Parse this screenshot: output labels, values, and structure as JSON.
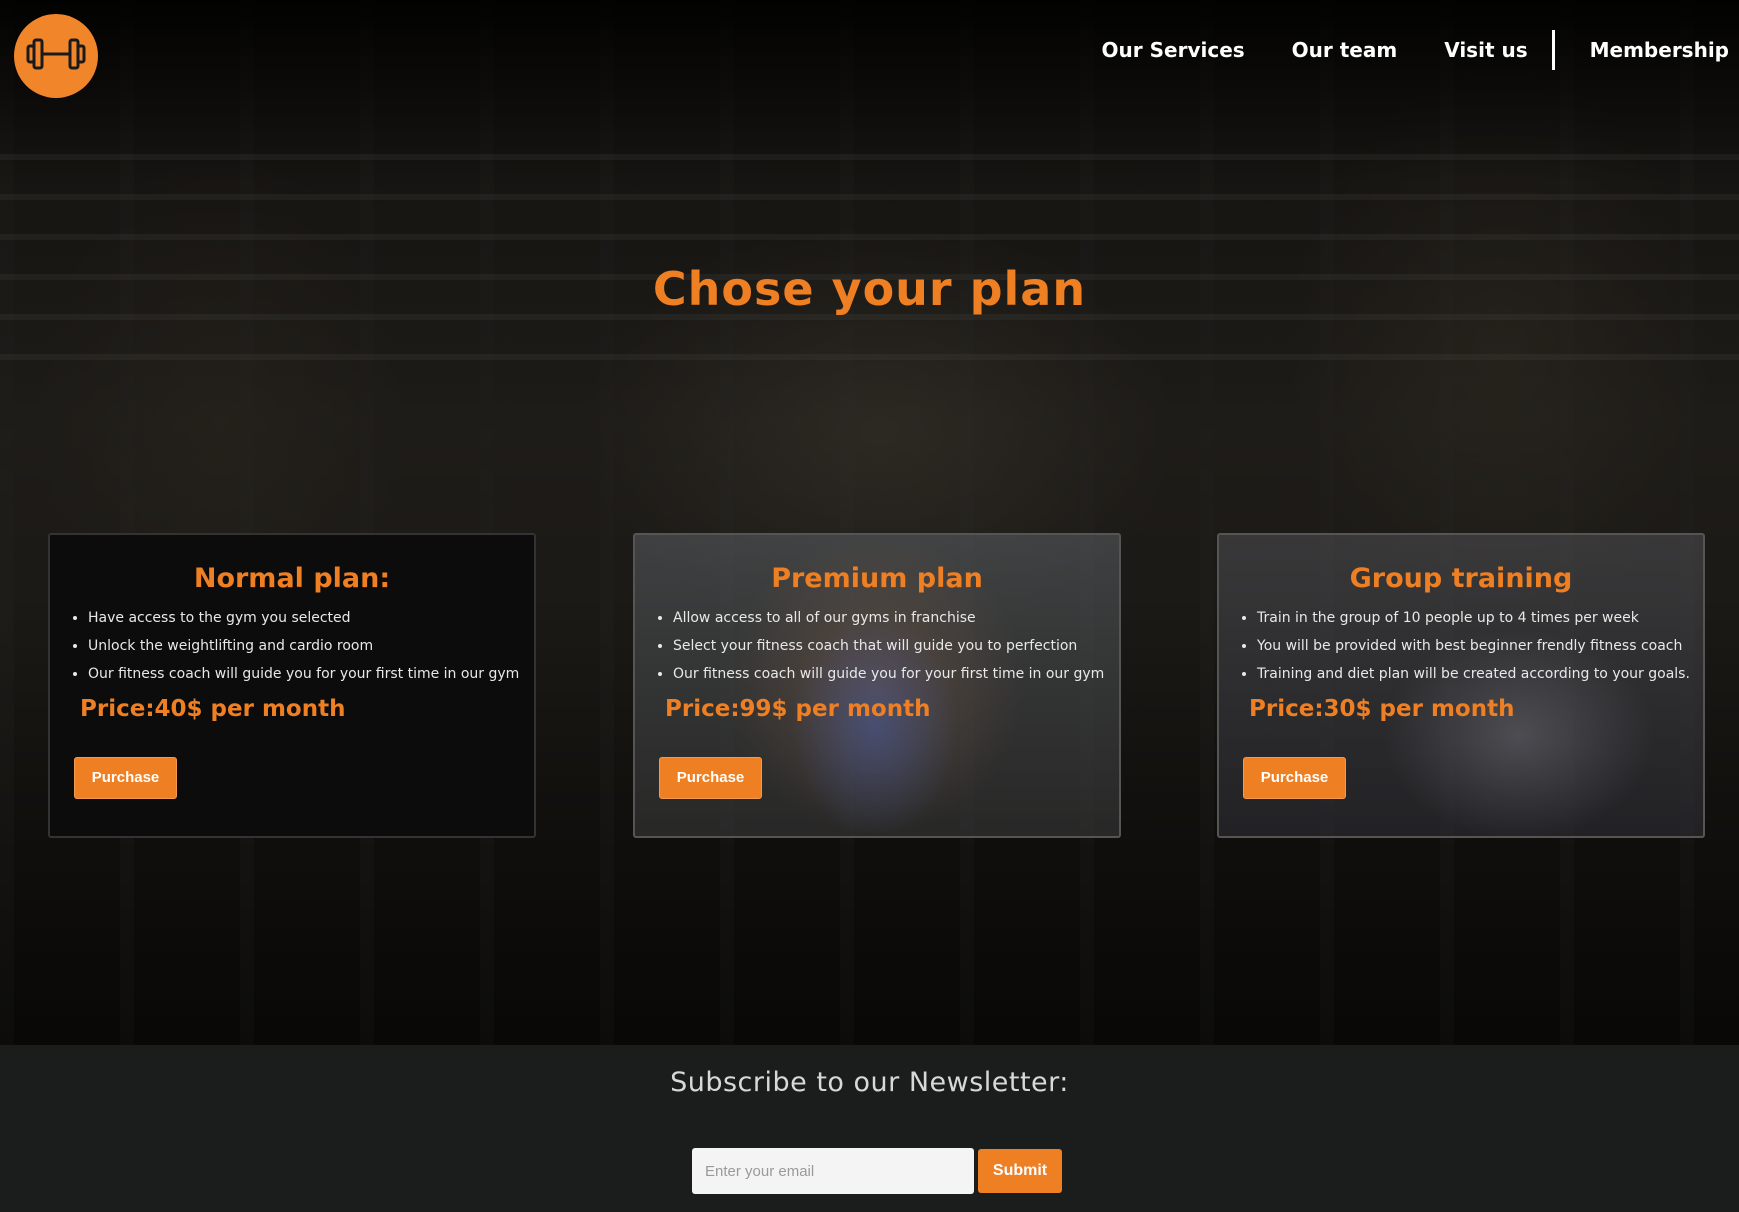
{
  "colors": {
    "accent": "#ee7f22",
    "background": "#0b0b0b",
    "footer": "#1b1d1d"
  },
  "header": {
    "logo_icon": "dumbbell-icon",
    "nav": [
      {
        "label": "Our Services"
      },
      {
        "label": "Our team"
      },
      {
        "label": "Visit us"
      },
      {
        "label": "Membership"
      }
    ]
  },
  "main": {
    "title": "Chose your plan"
  },
  "plans": [
    {
      "name": "Normal plan:",
      "features": [
        "Have access to the gym you selected",
        "Unlock the weightlifting and cardio room",
        "Our fitness coach will guide you for your first time in our gym"
      ],
      "price": "Price:40$ per month",
      "button": "Purchase"
    },
    {
      "name": "Premium plan",
      "features": [
        "Allow access to all of our gyms in franchise",
        "Select your fitness coach that will guide you to perfection",
        "Our fitness coach will guide you for your first time in our gym"
      ],
      "price": "Price:99$ per month",
      "button": "Purchase"
    },
    {
      "name": "Group training",
      "features": [
        "Train in the group of 10 people up to 4 times per week",
        "You will be provided with best beginner frendly fitness coach",
        "Training and diet plan will be created according to your goals."
      ],
      "price": "Price:30$ per month",
      "button": "Purchase"
    }
  ],
  "newsletter": {
    "title": "Subscribe to our Newsletter:",
    "email_placeholder": "Enter your email",
    "email_value": "",
    "submit_label": "Submit"
  }
}
